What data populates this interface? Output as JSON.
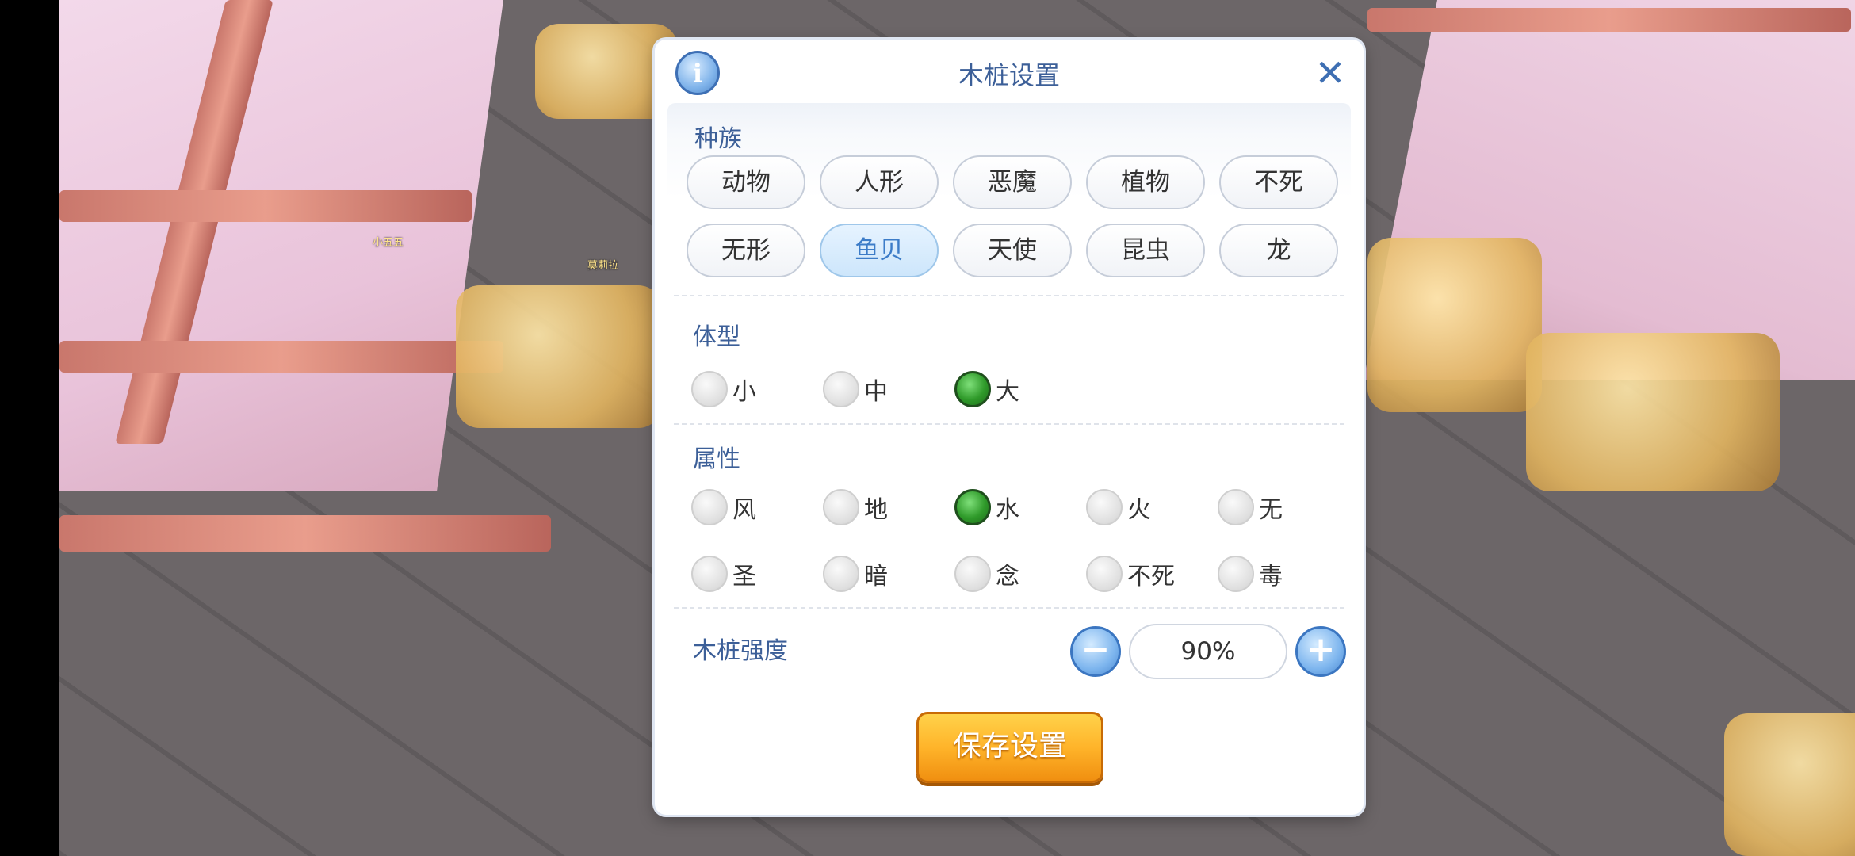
{
  "world": {
    "char_name_1": "小五五",
    "char_name_2": "莫莉拉"
  },
  "dialog": {
    "title": "木桩设置",
    "info_glyph": "i",
    "close_glyph": "✕",
    "race": {
      "label": "种族",
      "options": [
        "动物",
        "人形",
        "恶魔",
        "植物",
        "不死",
        "无形",
        "鱼贝",
        "天使",
        "昆虫",
        "龙"
      ],
      "selected": "鱼贝"
    },
    "size": {
      "label": "体型",
      "options": [
        "小",
        "中",
        "大"
      ],
      "selected": "大"
    },
    "element": {
      "label": "属性",
      "options": [
        "风",
        "地",
        "水",
        "火",
        "无",
        "圣",
        "暗",
        "念",
        "不死",
        "毒"
      ],
      "selected": "水"
    },
    "strength": {
      "label": "木桩强度",
      "minus_glyph": "−",
      "plus_glyph": "+",
      "value": "90%"
    },
    "save_label": "保存设置"
  },
  "colors": {
    "accent": "#3c5f98",
    "selected_radio": "#2f9a2a",
    "save_button": "#ffb42a"
  }
}
